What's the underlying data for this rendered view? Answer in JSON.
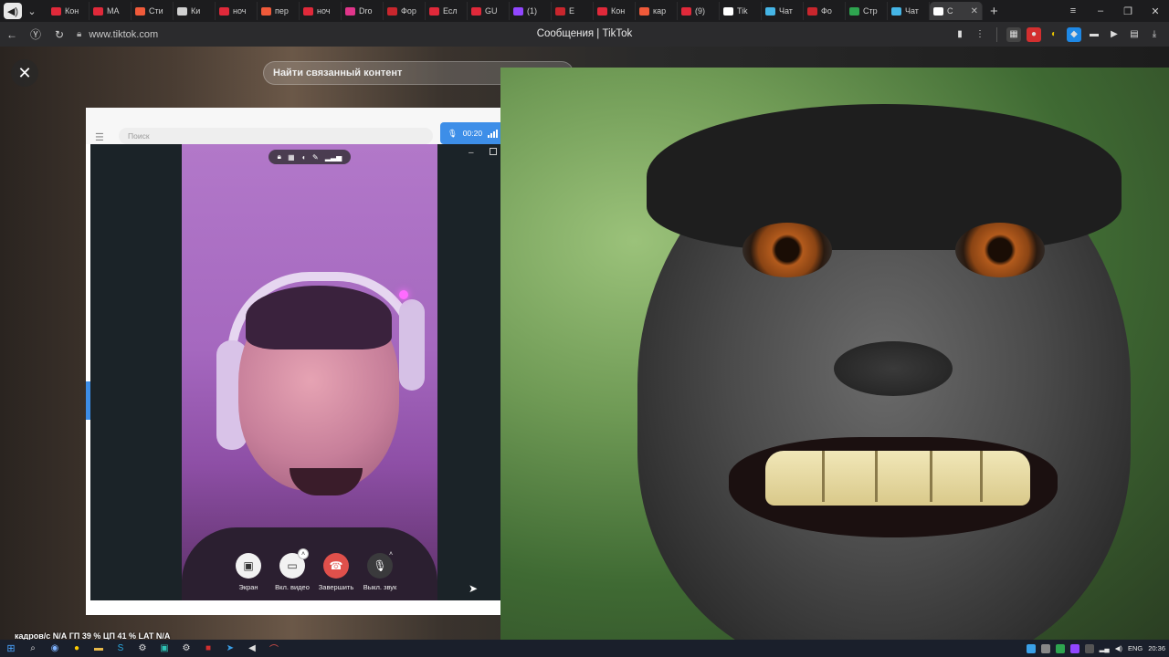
{
  "browser": {
    "tabs": [
      {
        "label": "Кон",
        "color": "#e0293a"
      },
      {
        "label": "MA",
        "color": "#e0293a"
      },
      {
        "label": "Сти",
        "color": "#f05a3a"
      },
      {
        "label": "Ки",
        "color": "#d0d0d0"
      },
      {
        "label": "ноч",
        "color": "#e0293a"
      },
      {
        "label": "пер",
        "color": "#f05a3a"
      },
      {
        "label": "ноч",
        "color": "#e0293a"
      },
      {
        "label": "Dro",
        "color": "#e0358a"
      },
      {
        "label": "Фор",
        "color": "#c8262d"
      },
      {
        "label": "Есл",
        "color": "#e0293a"
      },
      {
        "label": "GU",
        "color": "#e0293a"
      },
      {
        "label": "(1)",
        "color": "#9146ff"
      },
      {
        "label": "Е",
        "color": "#c8262d"
      },
      {
        "label": "Кон",
        "color": "#e0293a"
      },
      {
        "label": "кар",
        "color": "#f05a3a"
      },
      {
        "label": "(9)",
        "color": "#e0293a"
      },
      {
        "label": "Tik",
        "color": "#ffffff"
      },
      {
        "label": "Чат",
        "color": "#45b5e6"
      },
      {
        "label": "Фо",
        "color": "#c8262d"
      },
      {
        "label": "Стр",
        "color": "#2ea44f"
      },
      {
        "label": "Чат",
        "color": "#45b5e6"
      }
    ],
    "active_tab": {
      "label": "С",
      "close": "✕"
    },
    "new_tab": "+",
    "window_controls": {
      "menu": "≡",
      "minimize": "–",
      "restore": "❐",
      "close": "✕"
    },
    "url": "www.tiktok.com",
    "page_title": "Сообщения | TikTok"
  },
  "tiktok": {
    "related_search": "Найти связанный контент"
  },
  "messenger": {
    "search_placeholder": "Поиск",
    "call_timer": "00:20",
    "controls": {
      "screen": "Экран",
      "video_on": "Вкл. видео",
      "end": "Завершить",
      "mute": "Выкл. звук"
    },
    "accent": "#3d8ee8",
    "end_color": "#e0504b"
  },
  "osd": {
    "fps_label": "кадров/с",
    "fps_value": "N/A",
    "gpu_label": "ГП",
    "gpu_value": "39 %",
    "cpu_label": "ЦП",
    "cpu_value": "41 %",
    "lat_label": "LAT",
    "lat_value": "N/A"
  },
  "taskbar": {
    "lang": "ENG",
    "time": "20:36"
  }
}
